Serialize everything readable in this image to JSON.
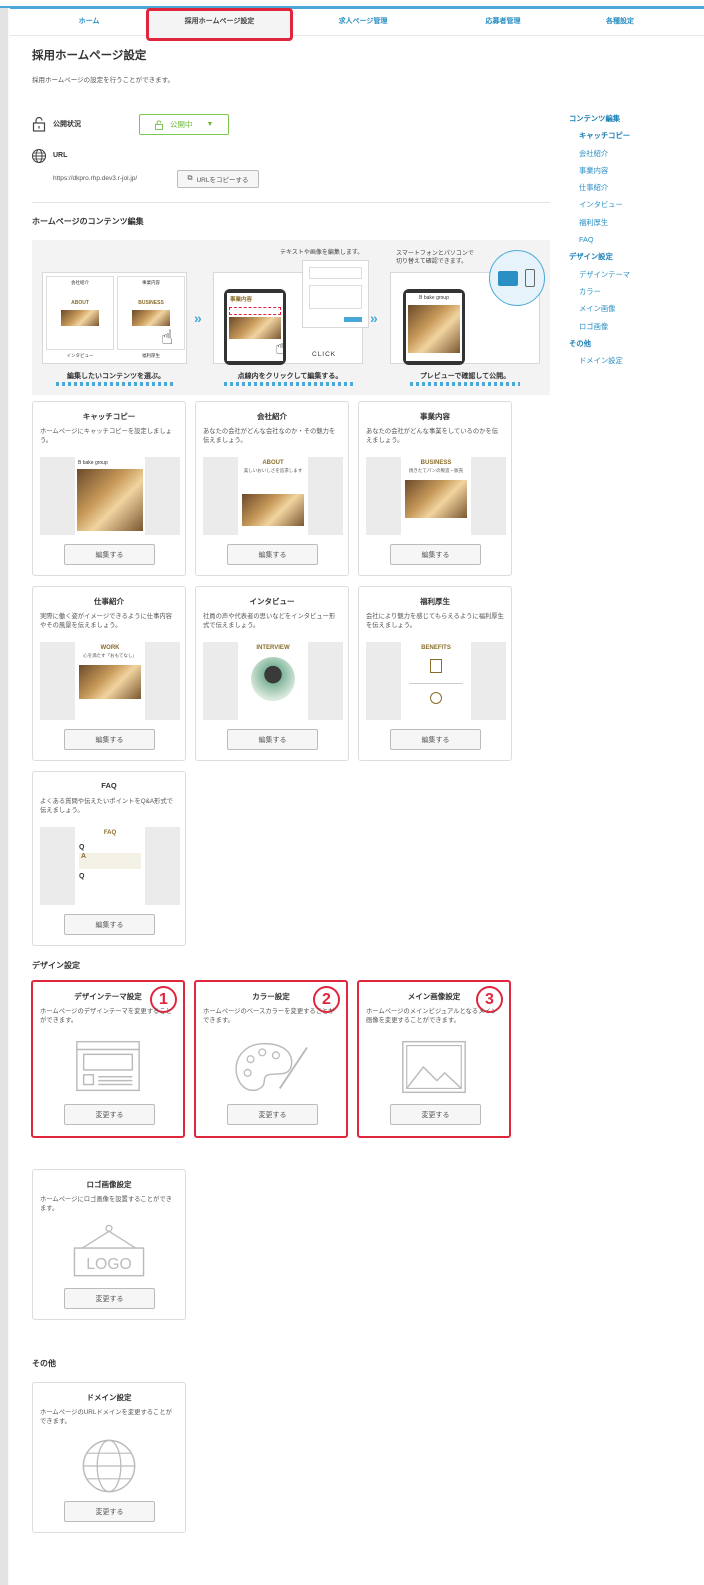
{
  "nav": {
    "tabs": [
      {
        "label": "ホーム"
      },
      {
        "label": "採用ホームページ設定"
      },
      {
        "label": "求人ページ管理"
      },
      {
        "label": "応募者管理"
      },
      {
        "label": "各種設定"
      }
    ]
  },
  "page": {
    "title": "採用ホームページ設定",
    "description": "採用ホームページの設定を行うことができます。"
  },
  "publish": {
    "label": "公開状況",
    "status": "公開中"
  },
  "url": {
    "label": "URL",
    "value": "https://dkpro.rhp.dev3.r-jol.jp/",
    "copy_button": "URLをコピーする"
  },
  "content_section": {
    "title": "ホームページのコンテンツ編集",
    "guide": {
      "step1_caption": "編集したいコンテンツを選ぶ。",
      "step2_caption": "点線内をクリックして編集する。",
      "step3_caption": "プレビューで確認して公開。",
      "note_edit": "テキストや画像を編集します。",
      "note_switch": "スマートフォンとパソコンで\n切り替えて確認できます。",
      "click_label": "CLICK",
      "panel_items": [
        "会社紹介",
        "事業内容",
        "インタビュー",
        "福利厚生"
      ],
      "brand": "B bake group"
    },
    "cards": [
      {
        "title": "キャッチコピー",
        "desc": "ホームページにキャッチコピーを設定しましょう。",
        "button": "編集する",
        "thumb_title": "B bake group"
      },
      {
        "title": "会社紹介",
        "desc": "あなたの会社がどんな会社なのか・その魅力を伝えましょう。",
        "button": "編集する",
        "thumb_title": "ABOUT",
        "thumb_sub": "美しいおいしさを追求します"
      },
      {
        "title": "事業内容",
        "desc": "あなたの会社がどんな事業をしているのかを伝えましょう。",
        "button": "編集する",
        "thumb_title": "BUSINESS",
        "thumb_sub": "焼きたてパンの製造・販売"
      },
      {
        "title": "仕事紹介",
        "desc": "実際に働く姿がイメージできるように仕事内容やその風景を伝えましょう。",
        "button": "編集する",
        "thumb_title": "WORK",
        "thumb_sub": "心を満たす「おもてなし」"
      },
      {
        "title": "インタビュー",
        "desc": "社員の声や代表者の思いなどをインタビュー形式で伝えましょう。",
        "button": "編集する",
        "thumb_title": "INTERVIEW"
      },
      {
        "title": "福利厚生",
        "desc": "会社により魅力を感じてもらえるように福利厚生を伝えましょう。",
        "button": "編集する",
        "thumb_title": "BENEFITS"
      },
      {
        "title": "FAQ",
        "desc": "よくある質問や伝えたいポイントをQ&A形式で伝えましょう。",
        "button": "編集する",
        "thumb_title": "FAQ"
      }
    ]
  },
  "design_section": {
    "title": "デザイン設定",
    "cards": [
      {
        "title": "デザインテーマ設定",
        "desc": "ホームページのデザインテーマを変更することができます。",
        "button": "変更する",
        "badge": "1",
        "icon": "layout-icon"
      },
      {
        "title": "カラー設定",
        "desc": "ホームページのベースカラーを変更することができます。",
        "button": "変更する",
        "badge": "2",
        "icon": "palette-icon"
      },
      {
        "title": "メイン画像設定",
        "desc": "ホームページのメインビジュアルとなるメイン画像を変更することができます。",
        "button": "変更する",
        "badge": "3",
        "icon": "image-icon"
      },
      {
        "title": "ロゴ画像設定",
        "desc": "ホームページにロゴ画像を設置することができます。",
        "button": "変更する",
        "icon": "logo-icon",
        "logo_text": "LOGO"
      }
    ]
  },
  "other_section": {
    "title": "その他",
    "cards": [
      {
        "title": "ドメイン設定",
        "desc": "ホームページのURLドメインを変更することができます。",
        "button": "変更する",
        "icon": "globe-icon"
      }
    ]
  },
  "sidebar": {
    "items": [
      {
        "label": "コンテンツ編集",
        "type": "h"
      },
      {
        "label": "キャッチコピー",
        "type": "act"
      },
      {
        "label": "会社紹介",
        "type": "sub"
      },
      {
        "label": "事業内容",
        "type": "sub"
      },
      {
        "label": "仕事紹介",
        "type": "sub"
      },
      {
        "label": "インタビュー",
        "type": "sub"
      },
      {
        "label": "福利厚生",
        "type": "sub"
      },
      {
        "label": "FAQ",
        "type": "sub"
      },
      {
        "label": "デザイン設定",
        "type": "h"
      },
      {
        "label": "デザインテーマ",
        "type": "sub"
      },
      {
        "label": "カラー",
        "type": "sub"
      },
      {
        "label": "メイン画像",
        "type": "sub"
      },
      {
        "label": "ロゴ画像",
        "type": "sub"
      },
      {
        "label": "その他",
        "type": "h"
      },
      {
        "label": "ドメイン設定",
        "type": "sub"
      }
    ]
  },
  "colors": {
    "accent": "#2a8fc4",
    "highlight": "#e0263d",
    "published": "#6cb83c"
  }
}
